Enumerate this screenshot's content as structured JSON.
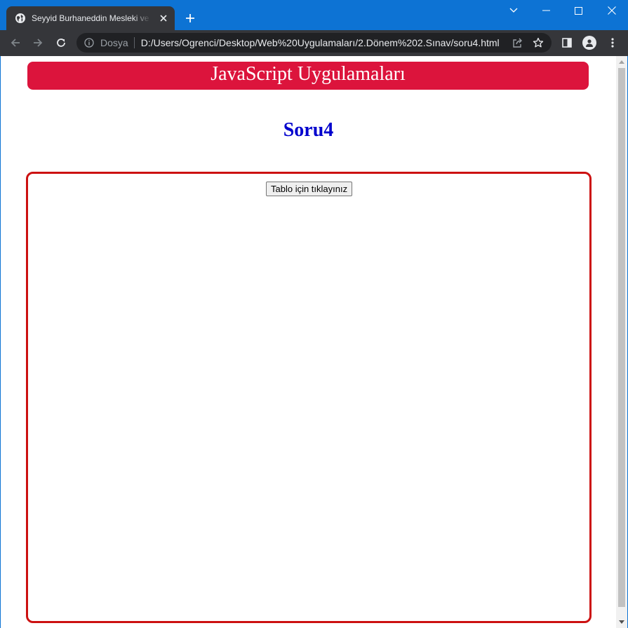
{
  "browser": {
    "tab": {
      "title": "Seyyid Burhaneddin Mesleki ve Teknik Anadolu Lisesi",
      "favicon": "globe-icon",
      "close_icon": "close-icon"
    },
    "new_tab_icon": "plus-icon",
    "window_controls": {
      "tab_search_icon": "chevron-down-icon",
      "minimize_icon": "minimize-icon",
      "maximize_icon": "maximize-icon",
      "close_icon": "close-icon"
    },
    "toolbar": {
      "back_icon": "arrow-left-icon",
      "forward_icon": "arrow-right-icon",
      "reload_icon": "reload-icon",
      "security_label": "Dosya",
      "url": "D:/Users/Ogrenci/Desktop/Web%20Uygulamaları/2.Dönem%202.Sınav/soru4.html",
      "share_icon": "share-icon",
      "bookmark_icon": "star-icon",
      "side_panel_icon": "side-panel-icon",
      "profile_icon": "avatar-icon",
      "menu_icon": "kebab-menu-icon"
    },
    "colors": {
      "frame": "#0d73d4",
      "toolbar": "#35363a",
      "omnibox": "#202124"
    }
  },
  "page": {
    "banner_title": "JavaScript Uygulamaları",
    "heading": "Soru4",
    "table_button_label": "Tablo için tıklayınız",
    "colors": {
      "banner_bg": "#dc143c",
      "heading": "#0000cd",
      "box_border": "#cc1111"
    }
  }
}
